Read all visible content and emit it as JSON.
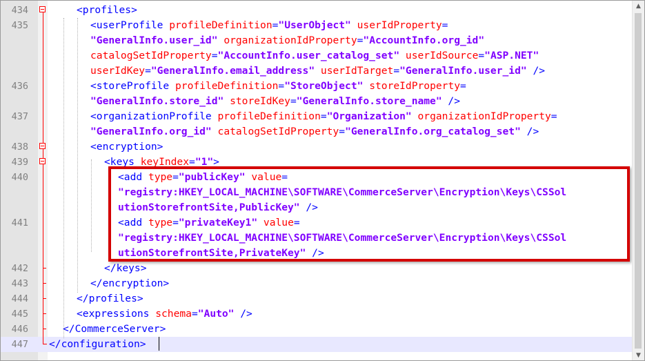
{
  "editor": {
    "line_numbers": [
      "434",
      "435",
      "436",
      "437",
      "438",
      "439",
      "440",
      "441",
      "442",
      "443",
      "444",
      "445",
      "446",
      "447"
    ],
    "lines": [
      [
        [
          "tag",
          "<profiles>"
        ]
      ],
      [
        [
          "tag",
          "<userProfile "
        ],
        [
          "attr",
          "profileDefinition"
        ],
        [
          "eq",
          "="
        ],
        [
          "val",
          "\"UserObject\""
        ],
        [
          "tag",
          " "
        ],
        [
          "attr",
          "userIdProperty"
        ],
        [
          "eq",
          "="
        ]
      ],
      [
        [
          "val",
          "\"GeneralInfo.user_id\""
        ],
        [
          "tag",
          " "
        ],
        [
          "attr",
          "organizationIdProperty"
        ],
        [
          "eq",
          "="
        ],
        [
          "val",
          "\"AccountInfo.org_id\""
        ]
      ],
      [
        [
          "attr",
          "catalogSetIdProperty"
        ],
        [
          "eq",
          "="
        ],
        [
          "val",
          "\"AccountInfo.user_catalog_set\""
        ],
        [
          "tag",
          " "
        ],
        [
          "attr",
          "userIdSource"
        ],
        [
          "eq",
          "="
        ],
        [
          "val",
          "\"ASP.NET\""
        ]
      ],
      [
        [
          "attr",
          "userIdKey"
        ],
        [
          "eq",
          "="
        ],
        [
          "val",
          "\"GeneralInfo.email_address\""
        ],
        [
          "tag",
          " "
        ],
        [
          "attr",
          "userIdTarget"
        ],
        [
          "eq",
          "="
        ],
        [
          "val",
          "\"GeneralInfo.user_id\""
        ],
        [
          "tag",
          " />"
        ]
      ],
      [
        [
          "tag",
          "<storeProfile "
        ],
        [
          "attr",
          "profileDefinition"
        ],
        [
          "eq",
          "="
        ],
        [
          "val",
          "\"StoreObject\""
        ],
        [
          "tag",
          " "
        ],
        [
          "attr",
          "storeIdProperty"
        ],
        [
          "eq",
          "="
        ]
      ],
      [
        [
          "val",
          "\"GeneralInfo.store_id\""
        ],
        [
          "tag",
          " "
        ],
        [
          "attr",
          "storeIdKey"
        ],
        [
          "eq",
          "="
        ],
        [
          "val",
          "\"GeneralInfo.store_name\""
        ],
        [
          "tag",
          " />"
        ]
      ],
      [
        [
          "tag",
          "<organizationProfile "
        ],
        [
          "attr",
          "profileDefinition"
        ],
        [
          "eq",
          "="
        ],
        [
          "val",
          "\"Organization\""
        ],
        [
          "tag",
          " "
        ],
        [
          "attr",
          "organizationIdProperty"
        ],
        [
          "eq",
          "="
        ]
      ],
      [
        [
          "val",
          "\"GeneralInfo.org_id\""
        ],
        [
          "tag",
          " "
        ],
        [
          "attr",
          "catalogSetIdProperty"
        ],
        [
          "eq",
          "="
        ],
        [
          "val",
          "\"GeneralInfo.org_catalog_set\""
        ],
        [
          "tag",
          " />"
        ]
      ],
      [
        [
          "tag",
          "<encryption>"
        ]
      ],
      [
        [
          "tag",
          "<keys "
        ],
        [
          "attr",
          "keyIndex"
        ],
        [
          "eq",
          "="
        ],
        [
          "val",
          "\"1\""
        ],
        [
          "tag",
          ">"
        ]
      ],
      [
        [
          "tag",
          "<add "
        ],
        [
          "attr",
          "type"
        ],
        [
          "eq",
          "="
        ],
        [
          "val",
          "\"publicKey\""
        ],
        [
          "tag",
          " "
        ],
        [
          "attr",
          "value"
        ],
        [
          "eq",
          "="
        ]
      ],
      [
        [
          "val",
          "\"registry:HKEY_LOCAL_MACHINE\\SOFTWARE\\CommerceServer\\Encryption\\Keys\\CSSol"
        ]
      ],
      [
        [
          "val",
          "utionStorefrontSite,PublicKey\""
        ],
        [
          "tag",
          " />"
        ]
      ],
      [
        [
          "tag",
          "<add "
        ],
        [
          "attr",
          "type"
        ],
        [
          "eq",
          "="
        ],
        [
          "val",
          "\"privateKey1\""
        ],
        [
          "tag",
          " "
        ],
        [
          "attr",
          "value"
        ],
        [
          "eq",
          "="
        ]
      ],
      [
        [
          "val",
          "\"registry:HKEY_LOCAL_MACHINE\\SOFTWARE\\CommerceServer\\Encryption\\Keys\\CSSol"
        ]
      ],
      [
        [
          "val",
          "utionStorefrontSite,PrivateKey\""
        ],
        [
          "tag",
          " />"
        ]
      ],
      [
        [
          "tag",
          "</keys>"
        ]
      ],
      [
        [
          "tag",
          "</encryption>"
        ]
      ],
      [
        [
          "tag",
          "</profiles>"
        ]
      ],
      [
        [
          "tag",
          "<expressions "
        ],
        [
          "attr",
          "schema"
        ],
        [
          "eq",
          "="
        ],
        [
          "val",
          "\"Auto\""
        ],
        [
          "tag",
          " />"
        ]
      ],
      [
        [
          "tag",
          "</CommerceServer>"
        ]
      ],
      [
        [
          "tag",
          "</configuration>"
        ]
      ]
    ],
    "colors": {
      "tag": "#0000ff",
      "attribute": "#ff0000",
      "value": "#8000ff",
      "fold_marker": "#ff0000",
      "highlight_box": "#d40000",
      "active_line": "#e8e8ff"
    },
    "icons": {
      "scroll_up": "▲",
      "scroll_down": "▼"
    }
  }
}
